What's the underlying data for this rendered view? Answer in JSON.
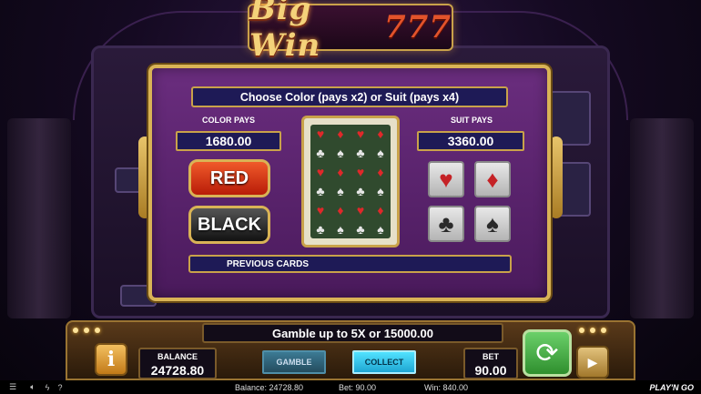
{
  "logo": {
    "title": "Big Win",
    "digits": "777"
  },
  "gamble": {
    "banner": "Choose Color (pays x2) or Suit (pays x4)",
    "color_pays_label": "COLOR PAYS",
    "color_pays_value": "1680.00",
    "suit_pays_label": "SUIT PAYS",
    "suit_pays_value": "3360.00",
    "red_label": "RED",
    "black_label": "BLACK",
    "previous_cards_label": "PREVIOUS CARDS",
    "suits": [
      {
        "name": "hearts",
        "glyph": "♥",
        "color": "#c52226"
      },
      {
        "name": "diamonds",
        "glyph": "♦",
        "color": "#c52226"
      },
      {
        "name": "clubs",
        "glyph": "♣",
        "color": "#2a2a2a"
      },
      {
        "name": "spades",
        "glyph": "♠",
        "color": "#2a2a2a"
      }
    ]
  },
  "console": {
    "message": "Gamble up to 5X or 15000.00",
    "balance_label": "BALANCE",
    "balance_value": "24728.80",
    "bet_label": "BET",
    "bet_value": "90.00",
    "gamble_button": "GAMBLE",
    "collect_button": "COLLECT",
    "info_glyph": "i"
  },
  "footer": {
    "balance": "Balance: 24728.80",
    "bet": "Bet: 90.00",
    "win": "Win: 840.00",
    "brand": "PLAY'N GO"
  },
  "colors": {
    "accent_gold": "#d9b356",
    "panel_purple": "#6a2d7e",
    "banner_navy": "#1e1a56",
    "spin_green": "#2f8f2e"
  }
}
